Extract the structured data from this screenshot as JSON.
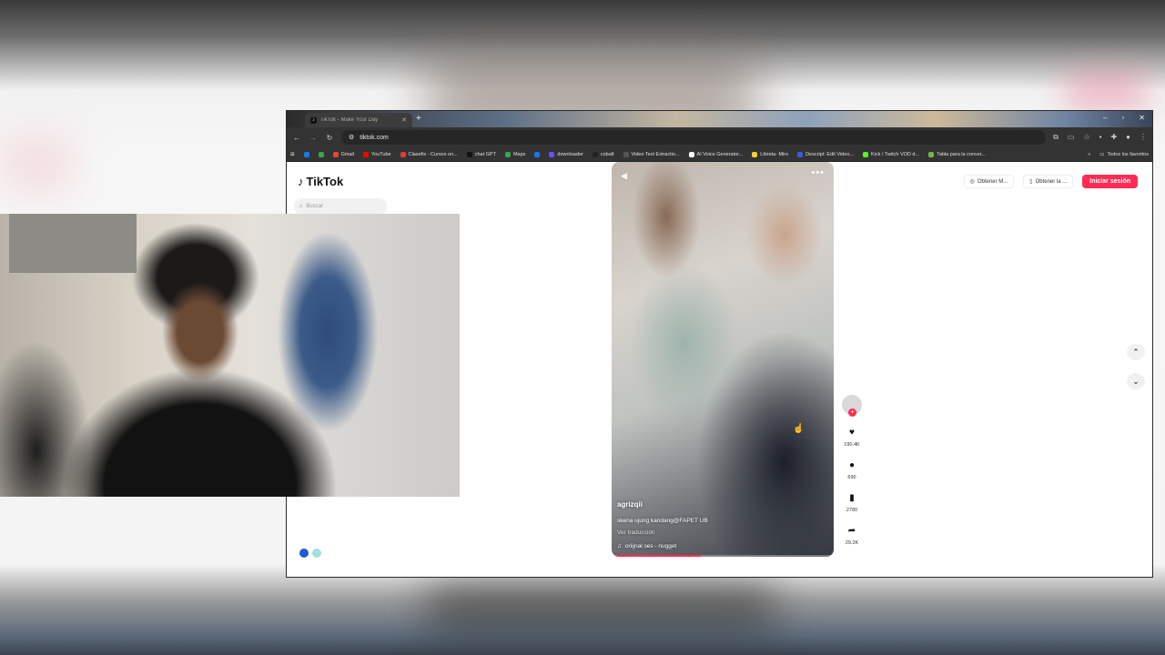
{
  "browser": {
    "tab_title": "TikTok - Make Your Day",
    "url": "tiktok.com",
    "bookmarks": [
      {
        "label": "Gmail",
        "color": "#ea4335"
      },
      {
        "label": "YouTube",
        "color": "#ff0000"
      },
      {
        "label": "Clasefix - Cursos on...",
        "color": "#e53935"
      },
      {
        "label": "chat GPT",
        "color": "#111111"
      },
      {
        "label": "Maps",
        "color": "#34a853"
      },
      {
        "label": "downloader",
        "color": "#1877f2"
      },
      {
        "label": "cobalt",
        "color": "#222222"
      },
      {
        "label": "Video Text Extractio...",
        "color": "#333333"
      },
      {
        "label": "AI Voice Generator...",
        "color": "#ffffff"
      },
      {
        "label": "Libreta- Miro",
        "color": "#ffd02f"
      },
      {
        "label": "Descript: Edit Video...",
        "color": "#3b5bdb"
      },
      {
        "label": "Kick / Twitch VOD d...",
        "color": "#53fc18"
      },
      {
        "label": "Tabla para la conver...",
        "color": "#7cb342"
      }
    ],
    "all_bookmarks_label": "Todos los favoritos"
  },
  "tiktok": {
    "logo_text": "TikTok",
    "search_placeholder": "Buscar",
    "header": {
      "link1": "Obtener M...",
      "link2": "Obtener la ...",
      "login": "Iniciar sesión"
    },
    "video": {
      "author": "agrizqii",
      "caption": "skena ujung kandang@FAPET UB",
      "translate": "Ver traducción",
      "sound": "oriijnal ses - nugget",
      "progress": 0.4
    },
    "actions": {
      "likes": "190.4K",
      "comments": "690",
      "saves": "2780",
      "shares": "29.2K"
    }
  },
  "colors": {
    "accent": "#fe2c55"
  }
}
